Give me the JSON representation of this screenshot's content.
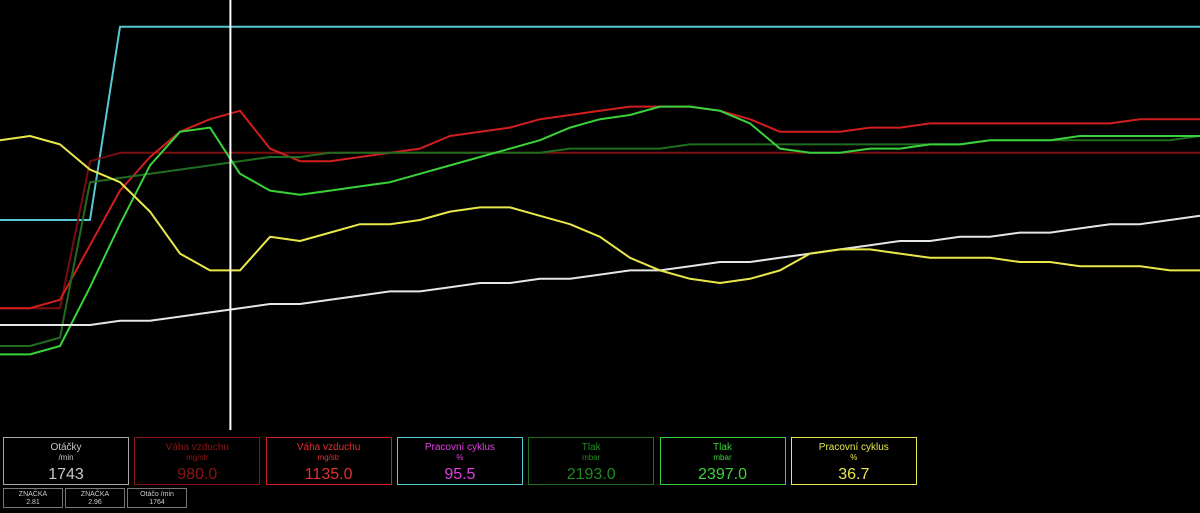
{
  "chart_data": {
    "type": "line",
    "x": [
      0,
      2.5,
      5,
      7.5,
      10,
      12.5,
      15,
      17.5,
      20,
      22.5,
      25,
      27.5,
      30,
      32.5,
      35,
      37.5,
      40,
      42.5,
      45,
      47.5,
      50,
      52.5,
      55,
      57.5,
      60,
      62.5,
      65,
      67.5,
      70,
      72.5,
      75,
      77.5,
      80,
      82.5,
      85,
      87.5,
      90,
      92.5,
      95,
      97.5,
      100
    ],
    "cursor_x": 19.2,
    "xlim": [
      0,
      100
    ],
    "ylim": [
      0,
      100
    ],
    "grid": false,
    "legend": "none",
    "series": [
      {
        "color": "#58c8d2",
        "values": [
          50,
          50,
          50,
          50,
          96,
          96,
          96,
          96,
          96,
          96,
          96,
          96,
          96,
          96,
          96,
          96,
          96,
          96,
          96,
          96,
          96,
          96,
          96,
          96,
          96,
          96,
          96,
          96,
          96,
          96,
          96,
          96,
          96,
          96,
          96,
          96,
          96,
          96,
          96,
          96,
          96
        ]
      },
      {
        "color": "#7a0e0e",
        "values": [
          29,
          29,
          29,
          64,
          66,
          66,
          66,
          66,
          66,
          66,
          66,
          66,
          66,
          66,
          66,
          66,
          66,
          66,
          66,
          66,
          66,
          66,
          66,
          66,
          66,
          66,
          66,
          66,
          66,
          66,
          66,
          66,
          66,
          66,
          66,
          66,
          66,
          66,
          66,
          66,
          66
        ]
      },
      {
        "color": "#d21e1e",
        "values": [
          29,
          29,
          31,
          44,
          57,
          65,
          71,
          74,
          76,
          67,
          64,
          64,
          65,
          66,
          67,
          70,
          71,
          72,
          74,
          75,
          76,
          77,
          77,
          77,
          76,
          74,
          71,
          71,
          71,
          72,
          72,
          73,
          73,
          73,
          73,
          73,
          73,
          73,
          74,
          74,
          74
        ]
      },
      {
        "color": "#1f6e1f",
        "values": [
          20,
          20,
          22,
          59,
          60,
          61,
          62,
          63,
          64,
          65,
          65,
          66,
          66,
          66,
          66,
          66,
          66,
          66,
          66,
          67,
          67,
          67,
          67,
          68,
          68,
          68,
          68,
          68,
          68,
          68,
          68,
          68,
          68,
          69,
          69,
          69,
          69,
          69,
          69,
          69,
          70
        ]
      },
      {
        "color": "#3ad23a",
        "values": [
          18,
          18,
          20,
          34,
          49,
          63,
          71,
          72,
          61,
          57,
          56,
          57,
          58,
          59,
          61,
          63,
          65,
          67,
          69,
          72,
          74,
          75,
          77,
          77,
          76,
          73,
          67,
          66,
          66,
          67,
          67,
          68,
          68,
          69,
          69,
          69,
          70,
          70,
          70,
          70,
          70
        ]
      },
      {
        "color": "#e6e6e6",
        "values": [
          25,
          25,
          25,
          25,
          26,
          26,
          27,
          28,
          29,
          30,
          30,
          31,
          32,
          33,
          33,
          34,
          35,
          35,
          36,
          36,
          37,
          38,
          38,
          39,
          40,
          40,
          41,
          42,
          43,
          44,
          45,
          45,
          46,
          46,
          47,
          47,
          48,
          49,
          49,
          50,
          51
        ]
      },
      {
        "color": "#e8e84a",
        "values": [
          69,
          70,
          68,
          62,
          59,
          52,
          42,
          38,
          38,
          46,
          45,
          47,
          49,
          49,
          50,
          52,
          53,
          53,
          51,
          49,
          46,
          41,
          38,
          36,
          35,
          36,
          38,
          42,
          43,
          43,
          42,
          41,
          41,
          41,
          40,
          40,
          39,
          39,
          39,
          38,
          38
        ]
      }
    ]
  },
  "panels": [
    {
      "label": "Otáčky",
      "unit": "/min",
      "value": "1743",
      "color": "#c8c8c8",
      "border": "#a8a8a8"
    },
    {
      "label": "Váha vzduchu",
      "unit": "mg/str",
      "value": "980.0",
      "color": "#8a1414",
      "border": "#8a1414"
    },
    {
      "label": "Váha vzduchu",
      "unit": "mg/str",
      "value": "1135.0",
      "color": "#e03030",
      "border": "#d21e1e"
    },
    {
      "label": "Pracovní cyklus",
      "unit": "%",
      "value": "95.5",
      "color": "#e040e0",
      "border": "#58c8d2"
    },
    {
      "label": "Tlak",
      "unit": "mbar",
      "value": "2193.0",
      "color": "#1f8a1f",
      "border": "#1f6e1f"
    },
    {
      "label": "Tlak",
      "unit": "mbar",
      "value": "2397.0",
      "color": "#3ad23a",
      "border": "#3ad23a"
    },
    {
      "label": "Pracovní cyklus",
      "unit": "%",
      "value": "36.7",
      "color": "#e8e84a",
      "border": "#e8e84a"
    }
  ],
  "markers": [
    {
      "label": "ZNAČKA",
      "value": "2.81"
    },
    {
      "label": "ZNAČKA",
      "value": "2.96"
    },
    {
      "label": "Otáčo /min",
      "value": "1764"
    }
  ]
}
